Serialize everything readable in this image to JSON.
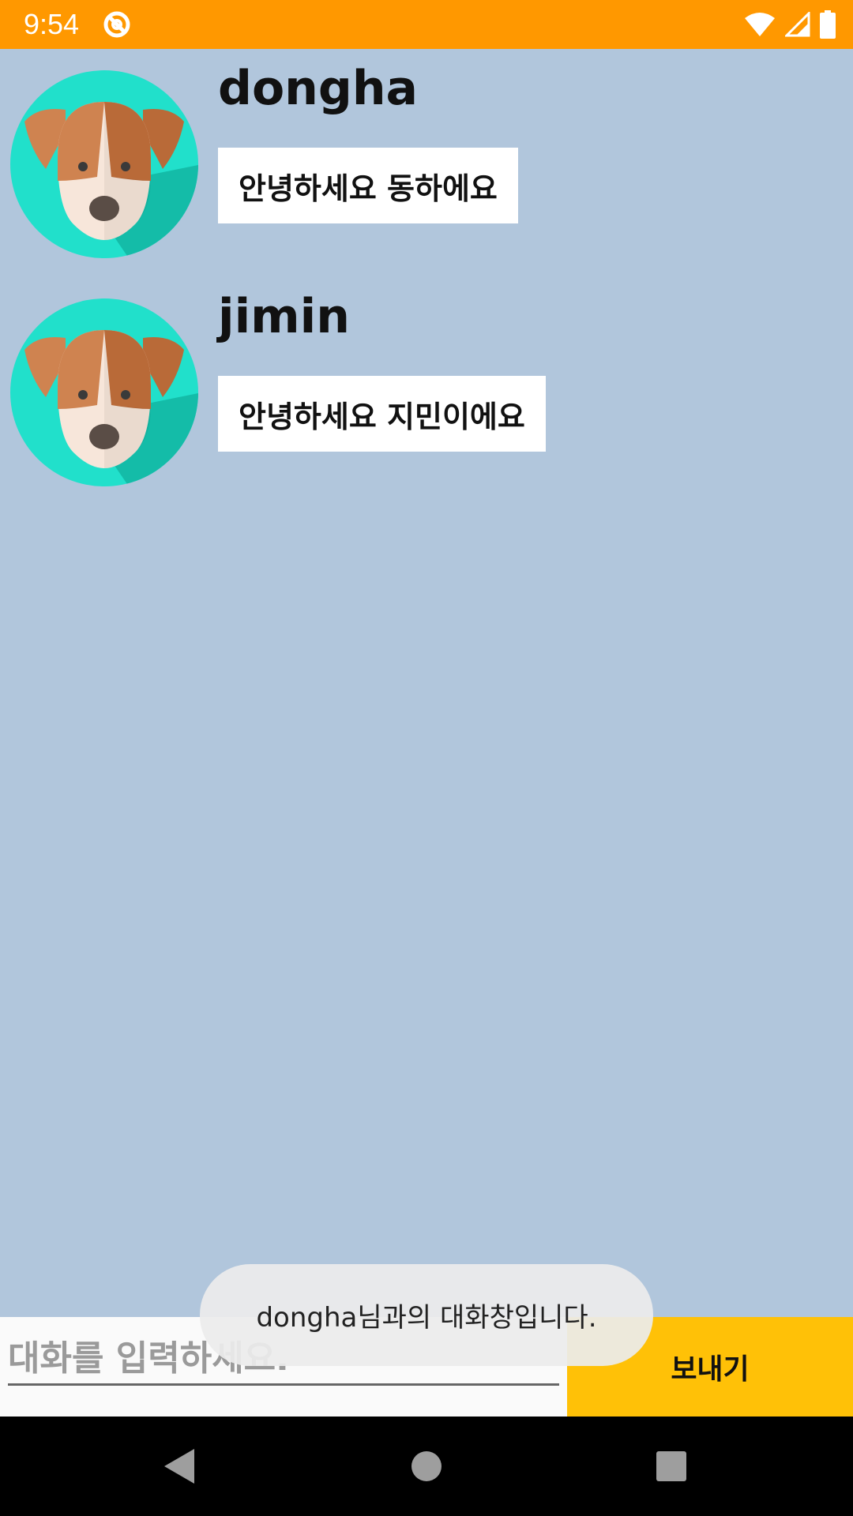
{
  "status_bar": {
    "time": "9:54",
    "background": "#ff9800",
    "icons": [
      "app-notification-icon",
      "wifi-icon",
      "cell-signal-icon",
      "battery-icon"
    ]
  },
  "chat": {
    "background": "#b1c6dc",
    "messages": [
      {
        "sender": "dongha",
        "text": "안녕하세요 동하에요",
        "avatar_icon": "dog-avatar-icon"
      },
      {
        "sender": "jimin",
        "text": "안녕하세요 지민이에요",
        "avatar_icon": "dog-avatar-icon"
      }
    ]
  },
  "input_bar": {
    "placeholder": "대화를 입력하세요.",
    "value": "",
    "send_label": "보내기",
    "send_color": "#ffc107"
  },
  "toast": {
    "text": "dongha님과의 대화창입니다."
  },
  "nav_bar": {
    "icons": [
      "back-icon",
      "home-icon",
      "recents-icon"
    ]
  }
}
